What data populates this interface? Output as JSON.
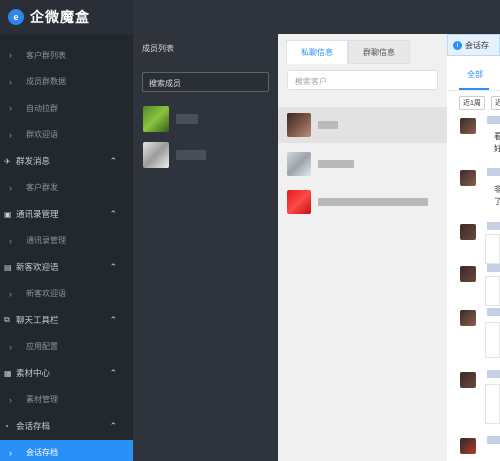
{
  "brand": {
    "logo_glyph": "e",
    "name": "企微魔盒"
  },
  "sidebar": {
    "items": [
      {
        "type": "sub",
        "label": "客户群列表"
      },
      {
        "type": "sub",
        "label": "成员群数据"
      },
      {
        "type": "sub",
        "label": "自动拉群"
      },
      {
        "type": "sub",
        "label": "群欢迎语"
      },
      {
        "type": "group",
        "label": "群发消息",
        "icon": "send-icon",
        "glyph": "✈"
      },
      {
        "type": "sub",
        "label": "客户群发"
      },
      {
        "type": "group",
        "label": "通讯录管理",
        "icon": "contacts-icon",
        "glyph": "▣"
      },
      {
        "type": "sub",
        "label": "通讯录管理"
      },
      {
        "type": "group",
        "label": "新客欢迎语",
        "icon": "welcome-icon",
        "glyph": "▤"
      },
      {
        "type": "sub",
        "label": "新客欢迎语"
      },
      {
        "type": "group",
        "label": "聊天工具栏",
        "icon": "toolbar-icon",
        "glyph": "⧉"
      },
      {
        "type": "sub",
        "label": "应用配置"
      },
      {
        "type": "group",
        "label": "素材中心",
        "icon": "material-icon",
        "glyph": "▦"
      },
      {
        "type": "sub",
        "label": "素材管理"
      },
      {
        "type": "group",
        "label": "会话存档",
        "icon": "archive-icon",
        "glyph": "◔"
      },
      {
        "type": "sub",
        "label": "会话存档",
        "active": true
      }
    ]
  },
  "members": {
    "title": "成员列表",
    "search_placeholder": "搜索成员"
  },
  "chats": {
    "tabs": [
      "私聊信息",
      "群聊信息"
    ],
    "active_tab": 0,
    "search_placeholder": "搜索客户"
  },
  "right": {
    "notice_text": "会话存",
    "tab_all": "全部",
    "filter_buttons": [
      "近1周",
      "近"
    ],
    "msg_texts": [
      "看",
      "好",
      "非",
      "了"
    ]
  },
  "colors": {
    "accent": "#2a8ff7",
    "sidebar_bg": "#23272e"
  }
}
